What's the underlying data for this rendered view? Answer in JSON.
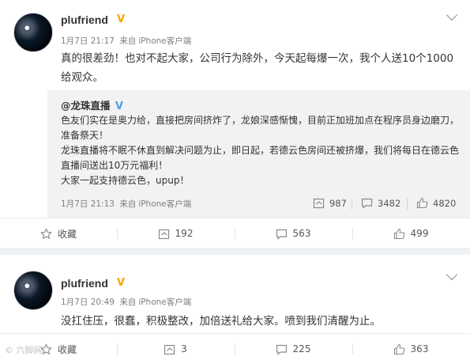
{
  "post1": {
    "username": "plufriend",
    "time": "1月7日 21:17",
    "source_prefix": "来自",
    "source": "iPhone客户端",
    "text": "真的很差劲！也对不起大家，公司行为除外，今天起每爆一次，我个人送10个1000给观众。",
    "repost": {
      "username": "@龙珠直播",
      "paragraphs": [
        "色友们实在是奥力给，直接把房间挤炸了，龙娘深感惭愧，目前正加班加点在程序员身边磨刀，准备祭天！",
        "龙珠直播将不眠不休直到解决问题为止，即日起，若德云色房间还被挤爆，我们将每日在德云色直播间送出10万元福利！",
        "大家一起支持德云色，upup！"
      ],
      "time": "1月7日 21:13",
      "source_prefix": "来自",
      "source": "iPhone客户端",
      "forwards": "987",
      "comments": "3482",
      "likes": "4820"
    },
    "actions": {
      "favorite": "收藏",
      "forwards": "192",
      "comments": "563",
      "likes": "499"
    }
  },
  "post2": {
    "username": "plufriend",
    "time": "1月7日 20:49",
    "source_prefix": "来自",
    "source": "iPhone客户端",
    "text": "没扛住压，很蠢，积极整改，加倍送礼给大家。喷到我们清醒为止。",
    "actions": {
      "favorite": "收藏",
      "forwards": "3",
      "comments": "225",
      "likes": "363"
    }
  },
  "watermark": "© 六脚网",
  "colors": {
    "verified_badge": "#f7a300",
    "repost_bg": "#f2f2f2",
    "separator": "#eef1f4",
    "meta_gray": "#808080"
  },
  "icons": [
    "star-icon",
    "forward-icon",
    "comment-icon",
    "thumbs-up-icon",
    "chevron-down-icon",
    "verified-badge-icon"
  ]
}
